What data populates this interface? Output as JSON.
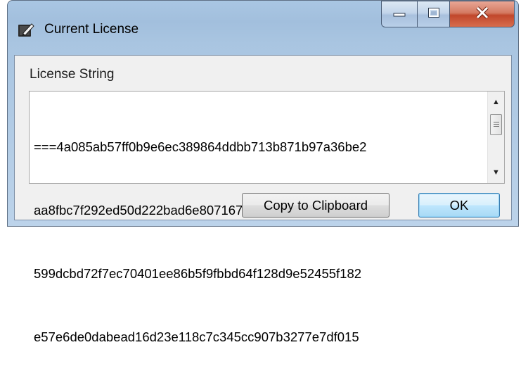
{
  "window": {
    "title": "Current License",
    "icon": "pen-icon",
    "controls": [
      "minimize-icon",
      "maximize-icon",
      "close-icon"
    ]
  },
  "license": {
    "label": "License String",
    "lines": [
      "===4a085ab57ff0b9e6ec389864ddbb713b871b97a36be2",
      "aa8fbc7f292ed50d222bad6e8071678626b0e611de5441c",
      "599dcbd72f7ec70401ee86b5f9fbbd64f128d9e52455f182",
      "e57e6de0dabead16d23e118c7c345cc907b3277e7df015"
    ]
  },
  "buttons": {
    "copy": "Copy to Clipboard",
    "ok": "OK"
  },
  "colors": {
    "titlebar": "#a9c6e3",
    "close_button": "#c1472b",
    "default_button_border": "#3c7fb1"
  }
}
